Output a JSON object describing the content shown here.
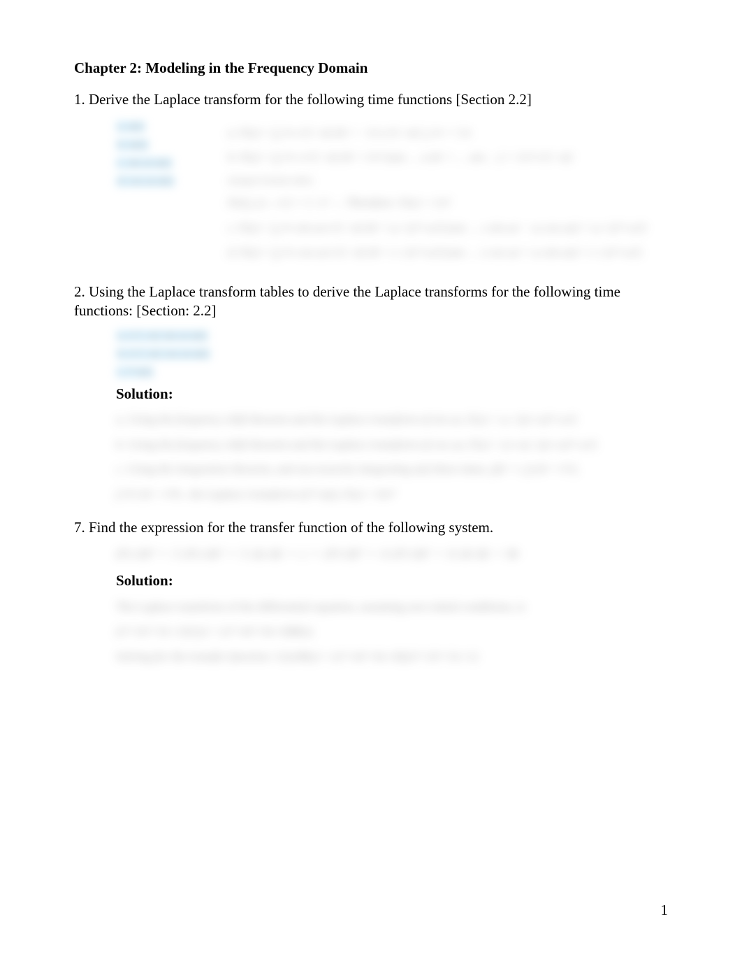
{
  "heading": "Chapter 2: Modeling in the Frequency Domain",
  "q1": {
    "text": "1. Derive the Laplace transform for the following time functions [Section 2.2]",
    "list_a": "a. u(t)",
    "list_b": "b. tu(t)",
    "list_c": "c. sin ωt u(t)",
    "list_d": "d. cos ωt u(t)",
    "sol_a": "a. F(s) = ∫₀^∞ e^{−st} dt = −1/s e^{−st} |₀^∞ = 1/s",
    "sol_b": "b. F(s) = ∫₀^∞ t e^{−st} dt = 1/s² (use … u dv = … see …) = 1/s² e^{−st}",
    "sol_b2": "(integral formula table)",
    "sol_ft": "F(s)|_{s→∞} = 1 / s²  →  Therefore: F(s) = 1/s²",
    "sol_c": "c. F(s) = ∫₀^∞ sin ωt e^{−st} dt = ω / (s²+ω²) (see … s sin ωt − ω cos ωt) = ω / (s²+ω²)",
    "sol_d": "d. F(s) = ∫₀^∞ cos ωt e^{−st} dt = s / (s²+ω²) (see … s cos ωt + ω sin ωt) = s / (s²+ω²)"
  },
  "q2": {
    "text": "2. Using the Laplace transform tables to derive the Laplace transforms for the following time functions: [Section: 2.2]",
    "list_a": "a. e^{−at} sin ωt u(t)",
    "list_b": "b. e^{−at} cos ωt u(t)",
    "list_c": "c. t³ u(t)",
    "solution_label": "Solution:",
    "sol_a": "a. Using the frequency shift theorem and the Laplace transform of sin ωt, F(s) = ω / ((s+a)²+ω²)",
    "sol_b": "b. Using the frequency shift theorem and the Laplace transform of cos ωt, F(s) = (s+a) / ((s+a)²+ω²)",
    "sol_c": "c. Using the integration theorem, and successively integrating u(t) three times, ∫dt = t, ∫t dt = t²/2,",
    "sol_c2": "∫ t²/2 dt = t³/6 , the Laplace transform of t³ u(t), F(s) = 6/s⁴"
  },
  "q7": {
    "text": "7. Find the expression for the transfer function of the following system.",
    "eq": "d³c/dt³ + 3 d²c/dt² + 5 dc/dt + c = d³r/dt³ + 4 d²r/dt² + 6 dr/dt + 8r",
    "solution_label": "Solution:",
    "sol_a": "The Laplace transform of the differential equation, assuming zero initial conditions, is",
    "sol_b": "(s³+3s²+5s+1)C(s) = (s³+4s²+6s+8)R(s).",
    "sol_c": "Solving for the transfer function:  C(s)/R(s) = (s³+4s²+6s+8)/(s³+3s²+5s+1)"
  },
  "page_number": "1"
}
